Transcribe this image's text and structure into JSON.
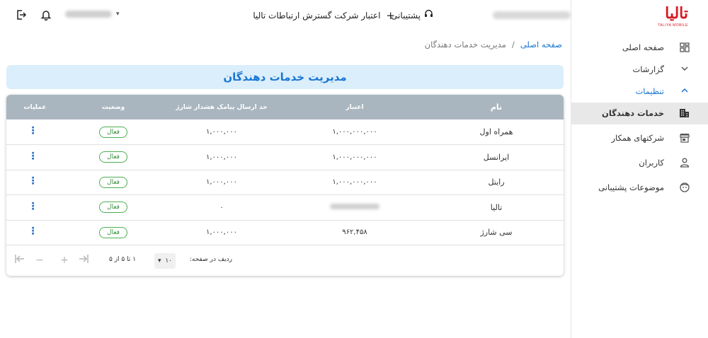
{
  "logo": {
    "main": "تالیا",
    "sub": "TALIYA MOBILE"
  },
  "sidebar": {
    "items": [
      {
        "label": "صفحه اصلی",
        "icon": "dashboard-icon"
      },
      {
        "label": "گزارشات",
        "icon": "chevron-down-icon"
      },
      {
        "label": "تنظیمات",
        "icon": "chevron-up-icon"
      },
      {
        "label": "خدمات دهندگان",
        "icon": "building-icon"
      },
      {
        "label": "شرکتهای همکار",
        "icon": "store-icon"
      },
      {
        "label": "کاربران",
        "icon": "person-icon"
      },
      {
        "label": "موضوعات پشتیبانی",
        "icon": "support-face-icon"
      }
    ]
  },
  "header": {
    "support_label": "پشتیبانی",
    "credit_label": "اعتبار شرکت گسترش ارتباطات تالیا"
  },
  "breadcrumb": {
    "home": "صفحه اصلی",
    "separator": "/",
    "current": "مدیریت خدمات دهندگان"
  },
  "page": {
    "title": "مدیریت خدمات دهندگان"
  },
  "table": {
    "columns": {
      "name": "نام",
      "credit": "اعتبار",
      "limit": "حد ارسال پیامک هشدار شارژ",
      "status": "وضعیت",
      "ops": "عملیات"
    },
    "rows": [
      {
        "name": "همراه اول",
        "credit": "۱,۰۰۰,۰۰۰,۰۰۰",
        "limit": "۱,۰۰۰,۰۰۰",
        "status": "فعال"
      },
      {
        "name": "ایرانسل",
        "credit": "۱,۰۰۰,۰۰۰,۰۰۰",
        "limit": "۱,۰۰۰,۰۰۰",
        "status": "فعال"
      },
      {
        "name": "رایتل",
        "credit": "۱,۰۰۰,۰۰۰,۰۰۰",
        "limit": "۱,۰۰۰,۰۰۰",
        "status": "فعال"
      },
      {
        "name": "تالیا",
        "credit": "",
        "limit": "۰",
        "status": "فعال"
      },
      {
        "name": "سی شارژ",
        "credit": "۹۶۲,۴۵۸",
        "limit": "۱,۰۰۰,۰۰۰",
        "status": "فعال"
      }
    ]
  },
  "pagination": {
    "rows_per_page_label": "ردیف در صفحه:",
    "rows_per_page": "۱۰",
    "range": "۱ تا ۵ از ۵"
  },
  "colors": {
    "accent": "#1976d2",
    "brand": "#d71920",
    "header_bg": "#a9b6bf",
    "active_green": "#4caf50"
  }
}
